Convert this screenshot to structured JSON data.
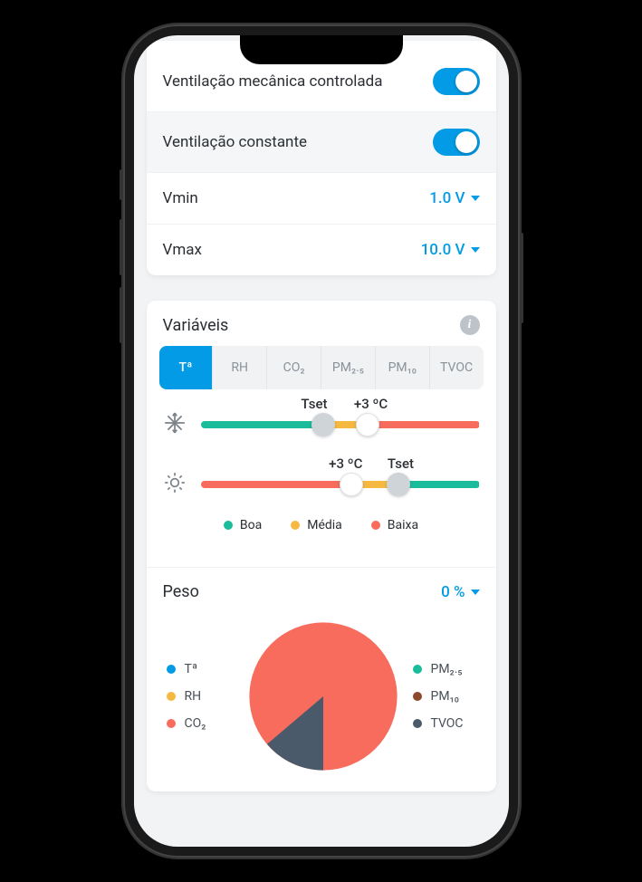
{
  "settings": {
    "vmc_label": "Ventilação mecânica controlada",
    "vmc_on": true,
    "constant_label": "Ventilação constante",
    "constant_on": true,
    "vmin_label": "Vmin",
    "vmin_value": "1.0 V",
    "vmax_label": "Vmax",
    "vmax_value": "10.0 V"
  },
  "variables": {
    "title": "Variáveis",
    "tabs": [
      "Tª",
      "RH",
      "CO₂",
      "PM₂.₅",
      "PM₁₀",
      "TVOC"
    ],
    "active_tab": 0,
    "sliders": {
      "cool": {
        "label_left": "Tset",
        "label_right": "+3 ºC",
        "handle1_pct": 44,
        "handle2_pct": 60,
        "seg1": 44,
        "seg2": 16,
        "seg3": 40
      },
      "heat": {
        "label_left": "+3 ºC",
        "label_right": "Tset",
        "handle1_pct": 54,
        "handle2_pct": 71,
        "seg1": 54,
        "seg2": 17,
        "seg3": 29
      }
    },
    "legend": {
      "good": "Boa",
      "mid": "Média",
      "low": "Baixa"
    }
  },
  "peso": {
    "title": "Peso",
    "value": "0 %",
    "legend_left": [
      {
        "label": "Tª",
        "color": "blue"
      },
      {
        "label": "RH",
        "color": "yellow"
      },
      {
        "label": "CO₂",
        "color": "red"
      }
    ],
    "legend_right": [
      {
        "label": "PM₂.₅",
        "color": "green"
      },
      {
        "label": "PM₁₀",
        "color": "brown"
      },
      {
        "label": "TVOC",
        "color": "slate"
      }
    ]
  },
  "chart_data": {
    "type": "pie",
    "title": "Peso",
    "series": [
      {
        "name": "Tª",
        "value": 0,
        "color": "#039be5"
      },
      {
        "name": "RH",
        "value": 0,
        "color": "#f5b942"
      },
      {
        "name": "CO₂",
        "value": 80,
        "color": "#f86c5e"
      },
      {
        "name": "PM₂.₅",
        "value": 0,
        "color": "#1abc9c"
      },
      {
        "name": "PM₁₀",
        "value": 0,
        "color": "#8b4a2b"
      },
      {
        "name": "TVOC",
        "value": 20,
        "color": "#4a5a6a"
      }
    ]
  }
}
